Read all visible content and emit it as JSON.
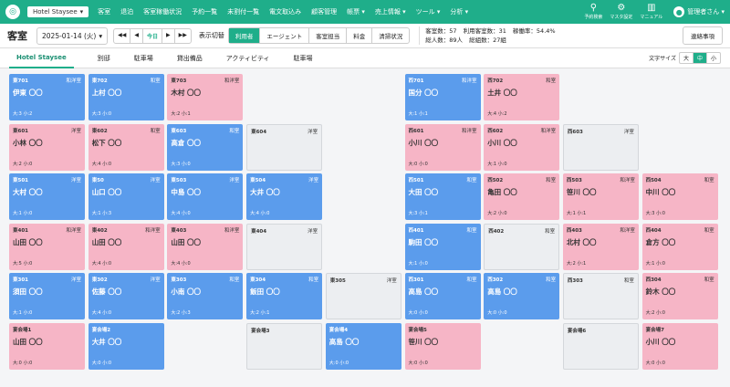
{
  "header": {
    "hotel": "Hotel Staysee",
    "nav": [
      "客室",
      "退泊",
      "客室稼働状況",
      "予約一覧",
      "未割付一覧",
      "電文取込み",
      "顧客管理",
      "帳票 ▾",
      "売上情報 ▾",
      "ツール ▾",
      "分析 ▾"
    ],
    "icons": {
      "search": "予約検索",
      "master": "マスタ設定",
      "manual": "マニュアル"
    },
    "user": "管理者さん ▾"
  },
  "toolbar": {
    "title": "客室",
    "date": "2025-01-14 (火)",
    "today": "今日",
    "switch_label": "表示切替",
    "views": [
      "利用者",
      "エージェント",
      "客室担当",
      "料金",
      "清掃状況"
    ],
    "active_view": "利用者",
    "stats": {
      "rooms": "客室数：57",
      "use_rooms": "利用客室数：31",
      "occupancy": "稼働率：54.4%",
      "guests": "総人数：89人",
      "groups": "総組数：27組"
    },
    "contact": "連絡事項"
  },
  "tabs": [
    "Hotel Staysee",
    "別邸",
    "駐車場",
    "貸出備品",
    "アクティビティ",
    "駐車場"
  ],
  "fontsize": {
    "label": "文字サイズ",
    "options": [
      "大",
      "中",
      "小"
    ],
    "active": "中"
  },
  "rooms": [
    {
      "id": "東701",
      "type": "和洋室",
      "color": "blue",
      "guest": "伊東 〇〇",
      "count": "大:3 小:2",
      "col": 0,
      "row": 0
    },
    {
      "id": "東702",
      "type": "和室",
      "color": "blue",
      "guest": "上村 〇〇",
      "count": "大:3 小:0",
      "col": 1,
      "row": 0
    },
    {
      "id": "東703",
      "type": "和洋室",
      "color": "pink",
      "guest": "木村 〇〇",
      "count": "大:2 小:1",
      "col": 2,
      "row": 0
    },
    {
      "id": "西701",
      "type": "和洋室",
      "color": "blue",
      "guest": "国分 〇〇",
      "count": "大:1 小:1",
      "col": 5,
      "row": 0
    },
    {
      "id": "西702",
      "type": "和室",
      "color": "pink",
      "guest": "土井 〇〇",
      "count": "大:4 小:2",
      "col": 6,
      "row": 0
    },
    {
      "id": "東601",
      "type": "洋室",
      "color": "pink",
      "guest": "小林 〇〇",
      "count": "大:2 小:0",
      "col": 0,
      "row": 1
    },
    {
      "id": "東602",
      "type": "和室",
      "color": "pink",
      "guest": "松下 〇〇",
      "count": "大:4 小:0",
      "col": 1,
      "row": 1
    },
    {
      "id": "東603",
      "type": "和室",
      "color": "blue",
      "guest": "高倉 〇〇",
      "count": "大:3 小:0",
      "col": 2,
      "row": 1
    },
    {
      "id": "東604",
      "type": "洋室",
      "color": "gray",
      "guest": "",
      "count": "",
      "col": 3,
      "row": 1
    },
    {
      "id": "西601",
      "type": "和洋室",
      "color": "pink",
      "guest": "小川 〇〇",
      "count": "大:0 小:0",
      "col": 5,
      "row": 1
    },
    {
      "id": "西602",
      "type": "和洋室",
      "color": "pink",
      "guest": "小川 〇〇",
      "count": "大:1 小:0",
      "col": 6,
      "row": 1
    },
    {
      "id": "西603",
      "type": "洋室",
      "color": "gray",
      "guest": "",
      "count": "",
      "col": 7,
      "row": 1
    },
    {
      "id": "東501",
      "type": "洋室",
      "color": "blue",
      "guest": "大村 〇〇",
      "count": "大:1 小:0",
      "col": 0,
      "row": 2
    },
    {
      "id": "東50",
      "type": "洋室",
      "color": "blue",
      "guest": "山口 〇〇",
      "count": "大:1 小:3",
      "col": 1,
      "row": 2
    },
    {
      "id": "東503",
      "type": "洋室",
      "color": "blue",
      "guest": "中島 〇〇",
      "count": "大:4 小:0",
      "col": 2,
      "row": 2
    },
    {
      "id": "東504",
      "type": "洋室",
      "color": "blue",
      "guest": "大井 〇〇",
      "count": "大:4 小:0",
      "col": 3,
      "row": 2
    },
    {
      "id": "西501",
      "type": "和室",
      "color": "blue",
      "guest": "大田 〇〇",
      "count": "大:3 小:1",
      "col": 5,
      "row": 2
    },
    {
      "id": "西502",
      "type": "和室",
      "color": "pink",
      "guest": "亀田 〇〇",
      "count": "大:2 小:0",
      "col": 6,
      "row": 2
    },
    {
      "id": "西503",
      "type": "和洋室",
      "color": "pink",
      "guest": "笹川 〇〇",
      "count": "大:1 小:1",
      "col": 7,
      "row": 2
    },
    {
      "id": "西504",
      "type": "和室",
      "color": "pink",
      "guest": "中川 〇〇",
      "count": "大:3 小:0",
      "col": 8,
      "row": 2
    },
    {
      "id": "東401",
      "type": "和洋室",
      "color": "pink",
      "guest": "山田 〇〇",
      "count": "大:5 小:0",
      "col": 0,
      "row": 3
    },
    {
      "id": "東402",
      "type": "和洋室",
      "color": "pink",
      "guest": "山田 〇〇",
      "count": "大:4 小:0",
      "col": 1,
      "row": 3
    },
    {
      "id": "東403",
      "type": "和洋室",
      "color": "pink",
      "guest": "山田 〇〇",
      "count": "大:4 小:0",
      "col": 2,
      "row": 3
    },
    {
      "id": "東404",
      "type": "洋室",
      "color": "gray",
      "guest": "",
      "count": "",
      "col": 3,
      "row": 3
    },
    {
      "id": "西401",
      "type": "和室",
      "color": "blue",
      "guest": "駒田 〇〇",
      "count": "大:1 小:0",
      "col": 5,
      "row": 3
    },
    {
      "id": "西402",
      "type": "和室",
      "color": "gray",
      "guest": "",
      "count": "",
      "col": 6,
      "row": 3
    },
    {
      "id": "西403",
      "type": "和洋室",
      "color": "pink",
      "guest": "北村 〇〇",
      "count": "大:2 小:1",
      "col": 7,
      "row": 3
    },
    {
      "id": "西404",
      "type": "和室",
      "color": "pink",
      "guest": "倉方 〇〇",
      "count": "大:1 小:0",
      "col": 8,
      "row": 3
    },
    {
      "id": "東301",
      "type": "洋室",
      "color": "blue",
      "guest": "須田 〇〇",
      "count": "大:1 小:0",
      "col": 0,
      "row": 4
    },
    {
      "id": "東302",
      "type": "洋室",
      "color": "blue",
      "guest": "佐藤 〇〇",
      "count": "大:4 小:0",
      "col": 1,
      "row": 4
    },
    {
      "id": "東303",
      "type": "和室",
      "color": "blue",
      "guest": "小南 〇〇",
      "count": "大:2 小:3",
      "col": 2,
      "row": 4
    },
    {
      "id": "東304",
      "type": "和室",
      "color": "blue",
      "guest": "飯田 〇〇",
      "count": "大:2 小:1",
      "col": 3,
      "row": 4
    },
    {
      "id": "東305",
      "type": "洋室",
      "color": "gray",
      "guest": "",
      "count": "",
      "col": 4,
      "row": 4
    },
    {
      "id": "西301",
      "type": "和室",
      "color": "blue",
      "guest": "高島 〇〇",
      "count": "大:0 小:0",
      "col": 5,
      "row": 4
    },
    {
      "id": "西302",
      "type": "和室",
      "color": "blue",
      "guest": "高島 〇〇",
      "count": "大:0 小:0",
      "col": 6,
      "row": 4
    },
    {
      "id": "西303",
      "type": "和室",
      "color": "gray",
      "guest": "",
      "count": "",
      "col": 7,
      "row": 4
    },
    {
      "id": "西304",
      "type": "和室",
      "color": "pink",
      "guest": "鈴木 〇〇",
      "count": "大:2 小:0",
      "col": 8,
      "row": 4
    },
    {
      "id": "宴会場1",
      "type": "",
      "color": "pink",
      "guest": "山田 〇〇",
      "count": "大:0 小:0",
      "col": 0,
      "row": 5
    },
    {
      "id": "宴会場2",
      "type": "",
      "color": "blue",
      "guest": "大井 〇〇",
      "count": "大:0 小:0",
      "col": 1,
      "row": 5
    },
    {
      "id": "宴会場3",
      "type": "",
      "color": "gray",
      "guest": "",
      "count": "",
      "col": 3,
      "row": 5
    },
    {
      "id": "宴会場4",
      "type": "",
      "color": "blue",
      "guest": "高島 〇〇",
      "count": "大:0 小:0",
      "col": 4,
      "row": 5
    },
    {
      "id": "宴会場5",
      "type": "",
      "color": "pink",
      "guest": "笹川 〇〇",
      "count": "大:0 小:0",
      "col": 5,
      "row": 5
    },
    {
      "id": "宴会場6",
      "type": "",
      "color": "gray",
      "guest": "",
      "count": "",
      "col": 7,
      "row": 5
    },
    {
      "id": "宴会場7",
      "type": "",
      "color": "pink",
      "guest": "小川 〇〇",
      "count": "大:0 小:0",
      "col": 8,
      "row": 5
    }
  ]
}
